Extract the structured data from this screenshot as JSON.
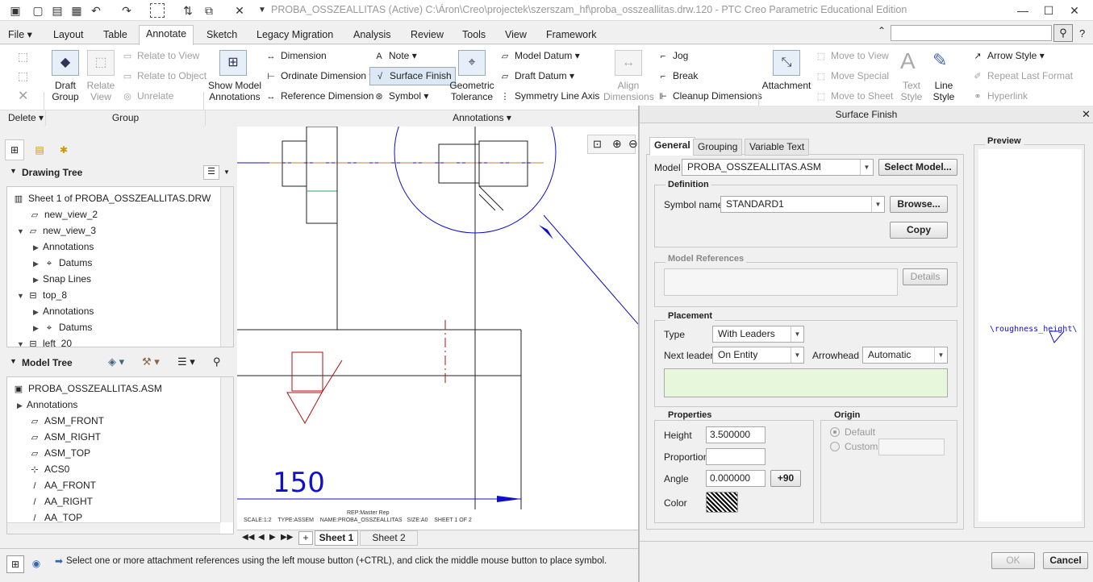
{
  "window": {
    "title": "PROBA_OSSZEALLITAS (Active) C:\\Áron\\Creo\\projectek\\szerszam_hf\\proba_osszeallitas.drw.120 - PTC Creo Parametric Educational Edition"
  },
  "tabs": [
    "Layout",
    "Table",
    "Annotate",
    "Sketch",
    "Legacy Migration",
    "Analysis",
    "Review",
    "Tools",
    "View",
    "Framework"
  ],
  "file_menu": "File",
  "ribbon": {
    "delete_group": "Delete",
    "group_label": "Group",
    "annotations_label": "Annotations",
    "draft_group": "Draft Group",
    "relate_view": "Relate View",
    "relate_to_view": "Relate to View",
    "relate_to_object": "Relate to Object",
    "unrelate": "Unrelate",
    "show_model_annotations": "Show Model Annotations",
    "dimension": "Dimension",
    "ordinate_dimension": "Ordinate Dimension",
    "reference_dimension": "Reference Dimension",
    "note": "Note",
    "surface_finish": "Surface Finish",
    "symbol": "Symbol",
    "geometric_tolerance": "Geometric Tolerance",
    "model_datum": "Model Datum",
    "draft_datum": "Draft Datum",
    "symmetry_line_axis": "Symmetry Line Axis",
    "align_dimensions": "Align Dimensions",
    "jog": "Jog",
    "break": "Break",
    "cleanup_dimensions": "Cleanup Dimensions",
    "attachment": "Attachment",
    "move_to_view": "Move to View",
    "move_special": "Move Special",
    "move_to_sheet": "Move to Sheet",
    "text_style": "Text Style",
    "line_style": "Line Style",
    "arrow_style": "Arrow Style",
    "repeat_last_format": "Repeat Last Format",
    "hyperlink": "Hyperlink"
  },
  "drawing_tree": {
    "title": "Drawing Tree",
    "items": [
      "Sheet 1 of PROBA_OSSZEALLITAS.DRW",
      "new_view_2",
      "new_view_3",
      "Annotations",
      "Datums",
      "Snap Lines",
      "top_8",
      "Annotations",
      "Datums",
      "left_20"
    ]
  },
  "model_tree": {
    "title": "Model Tree",
    "items": [
      "PROBA_OSSZEALLITAS.ASM",
      "Annotations",
      "ASM_FRONT",
      "ASM_RIGHT",
      "ASM_TOP",
      "ACS0",
      "AA_FRONT",
      "AA_RIGHT",
      "AA_TOP"
    ]
  },
  "canvas": {
    "dim_value": "150",
    "rep_line": "REP:Master Rep",
    "info_line": "SCALE:1:2    TYPE:ASSEM    NAME:PROBA_OSSZEALLITAS   SIZE:A0    SHEET 1 OF 2"
  },
  "sheets": [
    "Sheet 1",
    "Sheet 2"
  ],
  "status_text": "Select one or more attachment references using the left mouse button (+CTRL), and click the middle mouse button to place symbol.",
  "dialog": {
    "title": "Surface Finish",
    "tabs": [
      "General",
      "Grouping",
      "Variable Text"
    ],
    "model_label": "Model",
    "model_value": "PROBA_OSSZEALLITAS.ASM",
    "select_model": "Select Model...",
    "definition": "Definition",
    "symbol_name_label": "Symbol name",
    "symbol_name": "STANDARD1",
    "browse": "Browse...",
    "copy": "Copy",
    "model_references": "Model References",
    "details": "Details",
    "placement": "Placement",
    "type_label": "Type",
    "type_value": "With Leaders",
    "next_leader_label": "Next leader",
    "next_leader_value": "On Entity",
    "arrowhead_label": "Arrowhead",
    "arrowhead_value": "Automatic",
    "properties": "Properties",
    "height_label": "Height",
    "height_value": "3.500000",
    "proportion_label": "Proportion",
    "proportion_value": "",
    "angle_label": "Angle",
    "angle_value": "0.000000",
    "plus90": "+90",
    "color_label": "Color",
    "origin": "Origin",
    "default": "Default",
    "custom": "Custom",
    "preview": "Preview",
    "preview_text": "\\roughness_height\\",
    "ok": "OK",
    "cancel": "Cancel"
  },
  "colors": {
    "accent": "#0000cc",
    "drawing_red": "#b01010",
    "leader_blue": "#1010cc",
    "highlight_green": "#e6f7dc"
  }
}
